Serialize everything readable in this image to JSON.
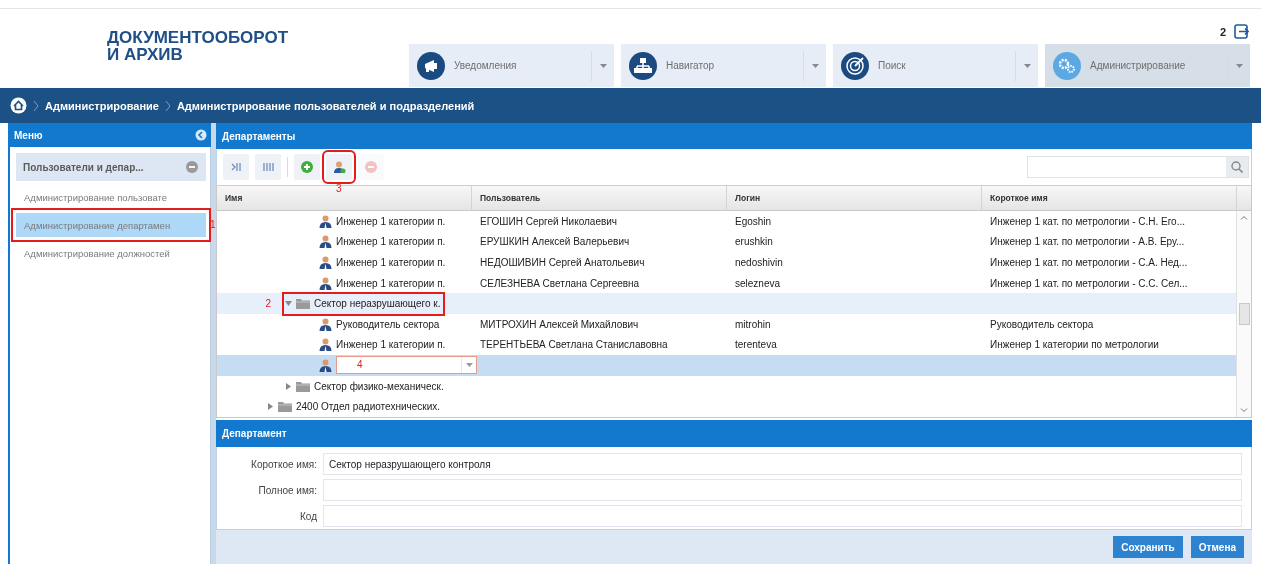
{
  "header": {
    "logo_lines": [
      "ДОКУМЕНТООБОРОТ",
      "И АРХИВ"
    ],
    "counter": "2"
  },
  "nav_tabs": [
    {
      "kind": "notifications",
      "label": "Уведомления",
      "selected": false
    },
    {
      "kind": "navigator",
      "label": "Навигатор",
      "selected": false
    },
    {
      "kind": "search",
      "label": "Поиск",
      "selected": false
    },
    {
      "kind": "admin",
      "label": "Администрирование",
      "selected": true
    }
  ],
  "breadcrumbs": [
    "Администрирование",
    "Администрирование пользователей и подразделений"
  ],
  "menu": {
    "title": "Меню",
    "group": {
      "label": "Пользователи и депар...",
      "expanded": true,
      "items": [
        {
          "label": "Администрирование пользовате",
          "selected": false
        },
        {
          "label": "Администрирование департамен",
          "selected": true,
          "callout": "1"
        },
        {
          "label": "Администрирование должностей",
          "selected": false
        }
      ]
    }
  },
  "departments": {
    "title": "Департаменты",
    "toolbar": [
      {
        "kind": "expand",
        "disabled": false
      },
      {
        "kind": "collapse",
        "disabled": false
      },
      {
        "kind": "add",
        "disabled": false
      },
      {
        "kind": "add-user",
        "disabled": false,
        "callout": "3"
      },
      {
        "kind": "remove",
        "disabled": true
      }
    ],
    "columns": [
      "Имя",
      "Пользователь",
      "Логин",
      "Короткое имя"
    ],
    "tree": [
      {
        "kind": "offscreen",
        "children": [
          {
            "kind": "offscreen",
            "children": [
              {
                "kind": "user",
                "name": "Инженер 1 категории п.",
                "user": "ЕГОШИН Сергей Николаевич",
                "login": "Egoshin",
                "short_name": "Инженер 1 кат. по метрологии - С.Н. Его...",
                "selected": false
              },
              {
                "kind": "user",
                "name": "Инженер 1 категории п.",
                "user": "ЕРУШКИН Алексей Валерьевич",
                "login": "erushkin",
                "short_name": "Инженер 1 кат. по метрологии - А.В. Еру...",
                "selected": false
              },
              {
                "kind": "user",
                "name": "Инженер 1 категории п.",
                "user": "НЕДОШИВИН Сергей Анатольевич",
                "login": "nedoshivin",
                "short_name": "Инженер 1 кат. по метрологии - С.А. Нед...",
                "selected": false
              },
              {
                "kind": "user",
                "name": "Инженер 1 категории п.",
                "user": "СЕЛЕЗНЕВА Светлана Сергеевна",
                "login": "selezneva",
                "short_name": "Инженер 1 кат. по метрологии - С.С. Сел...",
                "selected": false
              }
            ]
          },
          {
            "kind": "folder",
            "name": "Сектор неразрушающего к.",
            "expanded": true,
            "selected": true,
            "callout": "2",
            "children": [
              {
                "kind": "user",
                "name": "Руководитель сектора",
                "user": "МИТРОХИН Алексей Михайлович",
                "login": "mitrohin",
                "short_name": "Руководитель сектора",
                "selected": false
              },
              {
                "kind": "user",
                "name": "Инженер 1 категории п.",
                "user": "ТЕРЕНТЬЕВА Светлана Станиславовна",
                "login": "terenteva",
                "short_name": "Инженер 1 категории по метрологии",
                "selected": false
              },
              {
                "kind": "editor",
                "selected": true,
                "callout": "4"
              }
            ]
          },
          {
            "kind": "folder",
            "name": "Сектор физико-механическ.",
            "expanded": false,
            "selected": false
          }
        ]
      },
      {
        "kind": "folder",
        "name": "2400 Отдел радиотехнических.",
        "expanded": false,
        "selected": false
      }
    ]
  },
  "department": {
    "title": "Департамент",
    "fields": [
      {
        "label": "Короткое имя:",
        "value": "Сектор неразрушающего контроля"
      },
      {
        "label": "Полное имя:"
      },
      {
        "label": "Код"
      }
    ],
    "buttons": [
      "Сохранить",
      "Отмена"
    ]
  }
}
